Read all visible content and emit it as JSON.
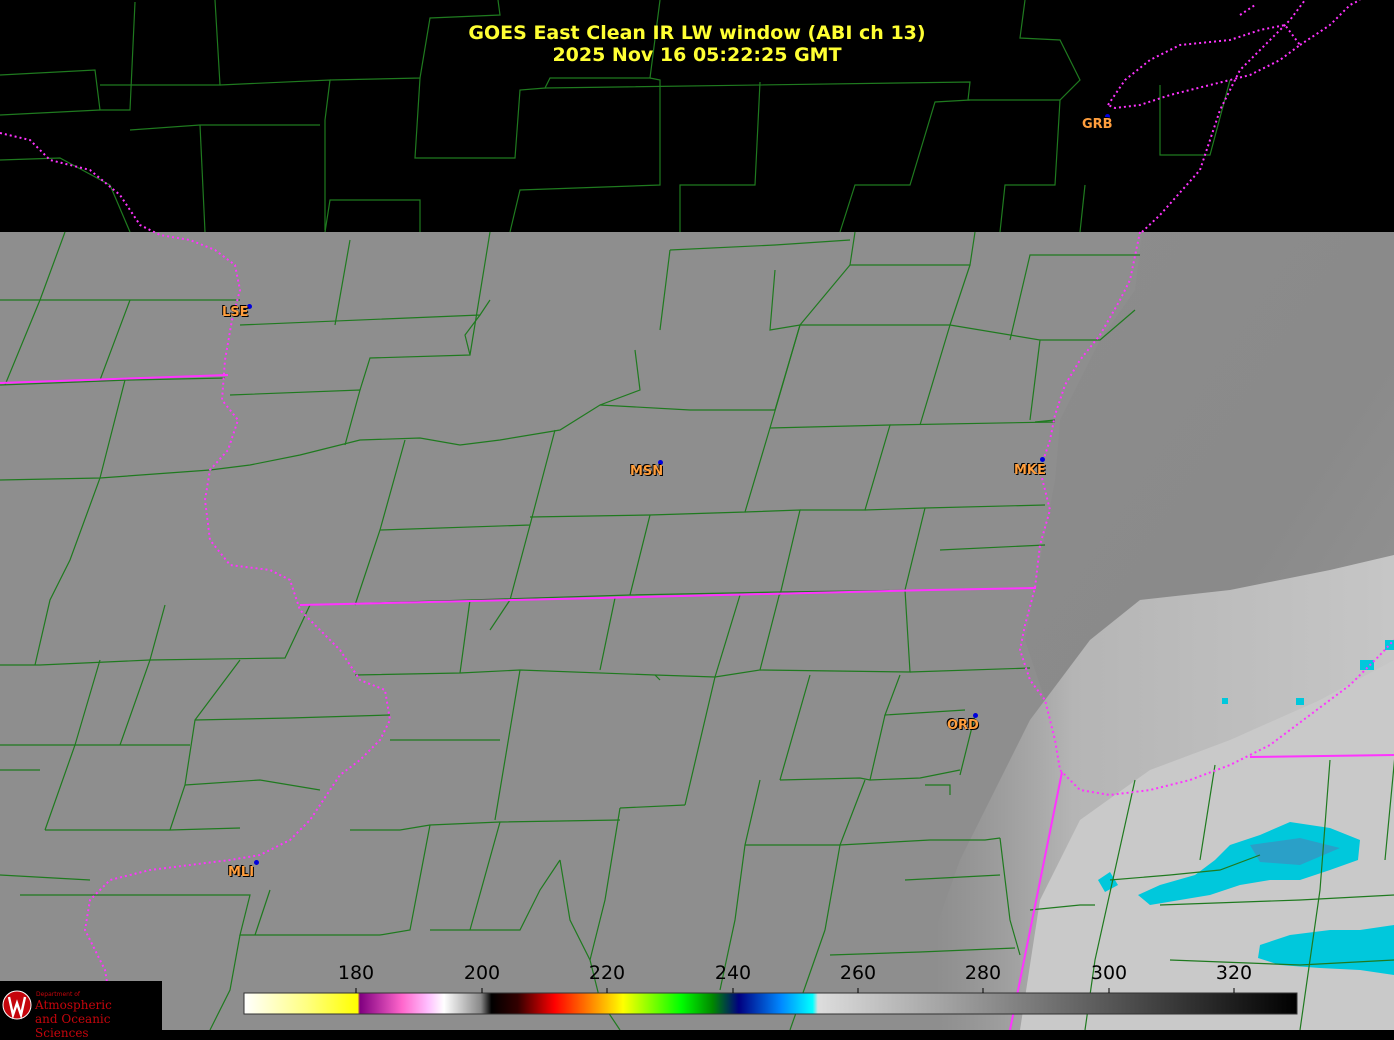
{
  "title": {
    "line1": "GOES East Clean IR LW window (ABI ch 13)",
    "line2": "2025 Nov 16  05:22:25 GMT"
  },
  "cities": [
    {
      "code": "GRB"
    },
    {
      "code": "LSE"
    },
    {
      "code": "MSN"
    },
    {
      "code": "MKE"
    },
    {
      "code": "ORD"
    },
    {
      "code": "MLI"
    }
  ],
  "colorbar": {
    "ticks": [
      "180",
      "200",
      "220",
      "240",
      "260",
      "280",
      "300",
      "320"
    ],
    "range": [
      165,
      333
    ]
  },
  "colors": {
    "title": "#ffff33",
    "county_lines": "#1f7a1f",
    "state_lines": "#ff33ff",
    "city_label": "#ff9e3d",
    "station_dot": "#0000dd",
    "surface_gray": "#8a8a8a",
    "cold_cloud": "#00c8dc"
  },
  "logo": {
    "dept": "Department of",
    "line1": "Atmospheric",
    "line2": "and Oceanic Sciences"
  }
}
